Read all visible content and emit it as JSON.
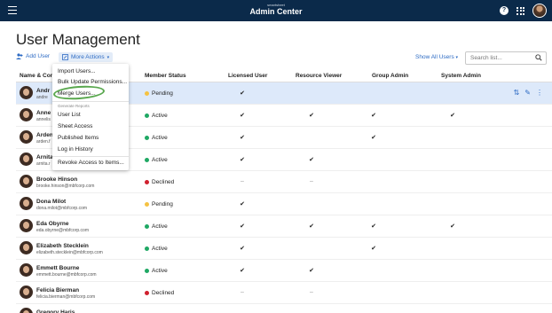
{
  "header": {
    "brand_small": "smartsheet",
    "brand_title": "Admin Center"
  },
  "page": {
    "title": "User Management"
  },
  "toolbar": {
    "add_user": "Add User",
    "more_actions": "More Actions",
    "show_all_users": "Show All Users",
    "search_placeholder": "Search list..."
  },
  "columns": {
    "name": "Name & Con",
    "member_status": "Member Status",
    "licensed_user": "Licensed User",
    "resource_viewer": "Resource Viewer",
    "group_admin": "Group Admin",
    "system_admin": "System Admin"
  },
  "menu": {
    "items_top": [
      "Import Users...",
      "Bulk Update Permissions...",
      "Merge Users..."
    ],
    "subheading": "Generate Reports",
    "reports": [
      "User List",
      "Sheet Access",
      "Published Items",
      "Log in History"
    ],
    "revoke": "Revoke Access to Items..."
  },
  "rows": [
    {
      "name": "Andr",
      "email": "andre",
      "status": "Pending",
      "status_color": "#f5c242",
      "licensed": "✔",
      "viewer": "",
      "group": "",
      "system": "",
      "selected": true
    },
    {
      "name": "Anne",
      "email": "annelis",
      "status": "Active",
      "status_color": "#1fa864",
      "licensed": "✔",
      "viewer": "✔",
      "group": "✔",
      "system": "✔"
    },
    {
      "name": "Arden",
      "email": "arden.f",
      "status": "Active",
      "status_color": "#1fa864",
      "licensed": "✔",
      "viewer": "",
      "group": "✔",
      "system": ""
    },
    {
      "name": "Arnita",
      "email": "arnita.r",
      "status": "Active",
      "status_color": "#1fa864",
      "licensed": "✔",
      "viewer": "✔",
      "group": "",
      "system": ""
    },
    {
      "name": "Brooke Hinson",
      "email": "brooke.hinson@mbfcorp.com",
      "status": "Declined",
      "status_color": "#d0202e",
      "licensed": "–",
      "viewer": "–",
      "group": "",
      "system": ""
    },
    {
      "name": "Dona Milot",
      "email": "dona.milot@mbfcorp.com",
      "status": "Pending",
      "status_color": "#f5c242",
      "licensed": "✔",
      "viewer": "",
      "group": "",
      "system": ""
    },
    {
      "name": "Eda Obyrne",
      "email": "eda.obyrne@mbfcorp.com",
      "status": "Active",
      "status_color": "#1fa864",
      "licensed": "✔",
      "viewer": "✔",
      "group": "✔",
      "system": "✔"
    },
    {
      "name": "Elizabeth Stecklein",
      "email": "elizabeth.stecklein@mbfcorp.com",
      "status": "Active",
      "status_color": "#1fa864",
      "licensed": "✔",
      "viewer": "",
      "group": "✔",
      "system": ""
    },
    {
      "name": "Emmett Bourne",
      "email": "emmett.bourne@mbfcorp.com",
      "status": "Active",
      "status_color": "#1fa864",
      "licensed": "✔",
      "viewer": "✔",
      "group": "",
      "system": ""
    },
    {
      "name": "Felicia Bierman",
      "email": "felicia.bierman@mbfcorp.com",
      "status": "Declined",
      "status_color": "#d0202e",
      "licensed": "–",
      "viewer": "–",
      "group": "",
      "system": ""
    },
    {
      "name": "Gregory Haris",
      "email": "",
      "status": "",
      "status_color": "#1fa864",
      "licensed": "",
      "viewer": "",
      "group": "",
      "system": ""
    }
  ],
  "icons": {
    "menu": "hamburger-icon",
    "help": "help-icon",
    "apps": "grid-icon",
    "search": "search-icon",
    "row_actions": [
      "merge-icon",
      "edit-icon",
      "more-icon"
    ]
  }
}
